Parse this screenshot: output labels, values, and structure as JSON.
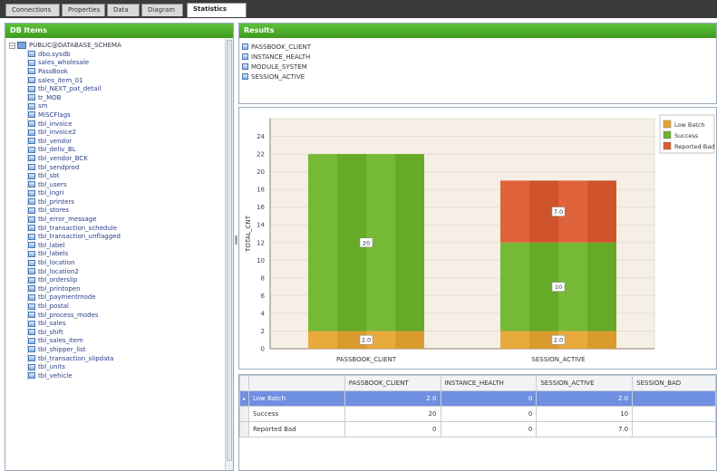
{
  "tabs": [
    {
      "label": "Connections"
    },
    {
      "label": "Properties"
    },
    {
      "label": "Data"
    },
    {
      "label": "Diagram"
    },
    {
      "label": "Statistics"
    }
  ],
  "left_pane": {
    "title": "DB Items",
    "root": "PUBLIC@DATABASE_SCHEMA",
    "items": [
      "dbo.sysdb",
      "sales_wholesale",
      "PassBook",
      "sales_item_01",
      "tbl_NEXT_pat_detail",
      "tr_MOB",
      "sm",
      "MISCFlags",
      "tbl_invoice",
      "tbl_invoice2",
      "tbl_vendor",
      "tbl_deliv_BL",
      "tbl_vendor_BCK",
      "tbl_sendprod",
      "tbl_sbt",
      "tbl_users",
      "tbl_ingri",
      "tbl_printers",
      "tbl_stores",
      "tbl_error_message",
      "tbl_transaction_schedule",
      "tbl_transaction_unflagged",
      "tbl_label",
      "tbl_labels",
      "tbl_location",
      "tbl_location2",
      "tbl_orderslip",
      "tbl_printopen",
      "tbl_paymentmode",
      "tbl_postal",
      "tbl_process_modes",
      "tbl_sales",
      "tbl_shift",
      "tbl_sales_item",
      "tbl_shipper_list",
      "tbl_transaction_slipdata",
      "tbl_units",
      "tbl_vehicle"
    ]
  },
  "right_top": {
    "title": "Results",
    "items": [
      "PASSBOOK_CLIENT",
      "INSTANCE_HEALTH",
      "MODULE_SYSTEM",
      "SESSION_ACTIVE"
    ]
  },
  "chart_data": {
    "type": "bar",
    "stacked": true,
    "categories": [
      "PASSBOOK_CLIENT",
      "SESSION_ACTIVE"
    ],
    "ylabel": "TOTAL_CNT",
    "ylim": [
      0,
      26
    ],
    "yticks": [
      0,
      2,
      4,
      6,
      8,
      10,
      12,
      14,
      16,
      18,
      20,
      22,
      24
    ],
    "legend_position": "top-right",
    "series": [
      {
        "name": "Low Batch",
        "color": "#e8a531",
        "values": [
          2,
          2
        ],
        "labels": [
          "2.0",
          "2.0"
        ]
      },
      {
        "name": "Success",
        "color": "#6db52b",
        "values": [
          20,
          10
        ],
        "labels": [
          "20",
          "10"
        ]
      },
      {
        "name": "Reported Bad",
        "color": "#dd5a2e",
        "values": [
          0,
          7
        ],
        "labels": [
          "",
          "7.0"
        ]
      }
    ]
  },
  "grid": {
    "headers": [
      "",
      "PASSBOOK_CLIENT",
      "INSTANCE_HEALTH",
      "SESSION_ACTIVE",
      "SESSION_BAD"
    ],
    "rows": [
      {
        "selected": true,
        "cells": [
          "Low Batch",
          "2.0",
          "0",
          "2.0",
          ""
        ]
      },
      {
        "selected": false,
        "cells": [
          "Success",
          "20",
          "0",
          "10",
          ""
        ]
      },
      {
        "selected": false,
        "cells": [
          "Reported Bad",
          "0",
          "0",
          "7.0",
          ""
        ]
      }
    ]
  },
  "colors": {
    "header_green": "#4caf2a",
    "selection_blue": "#6f8fe0",
    "tree_text": "#2b3f8a"
  }
}
